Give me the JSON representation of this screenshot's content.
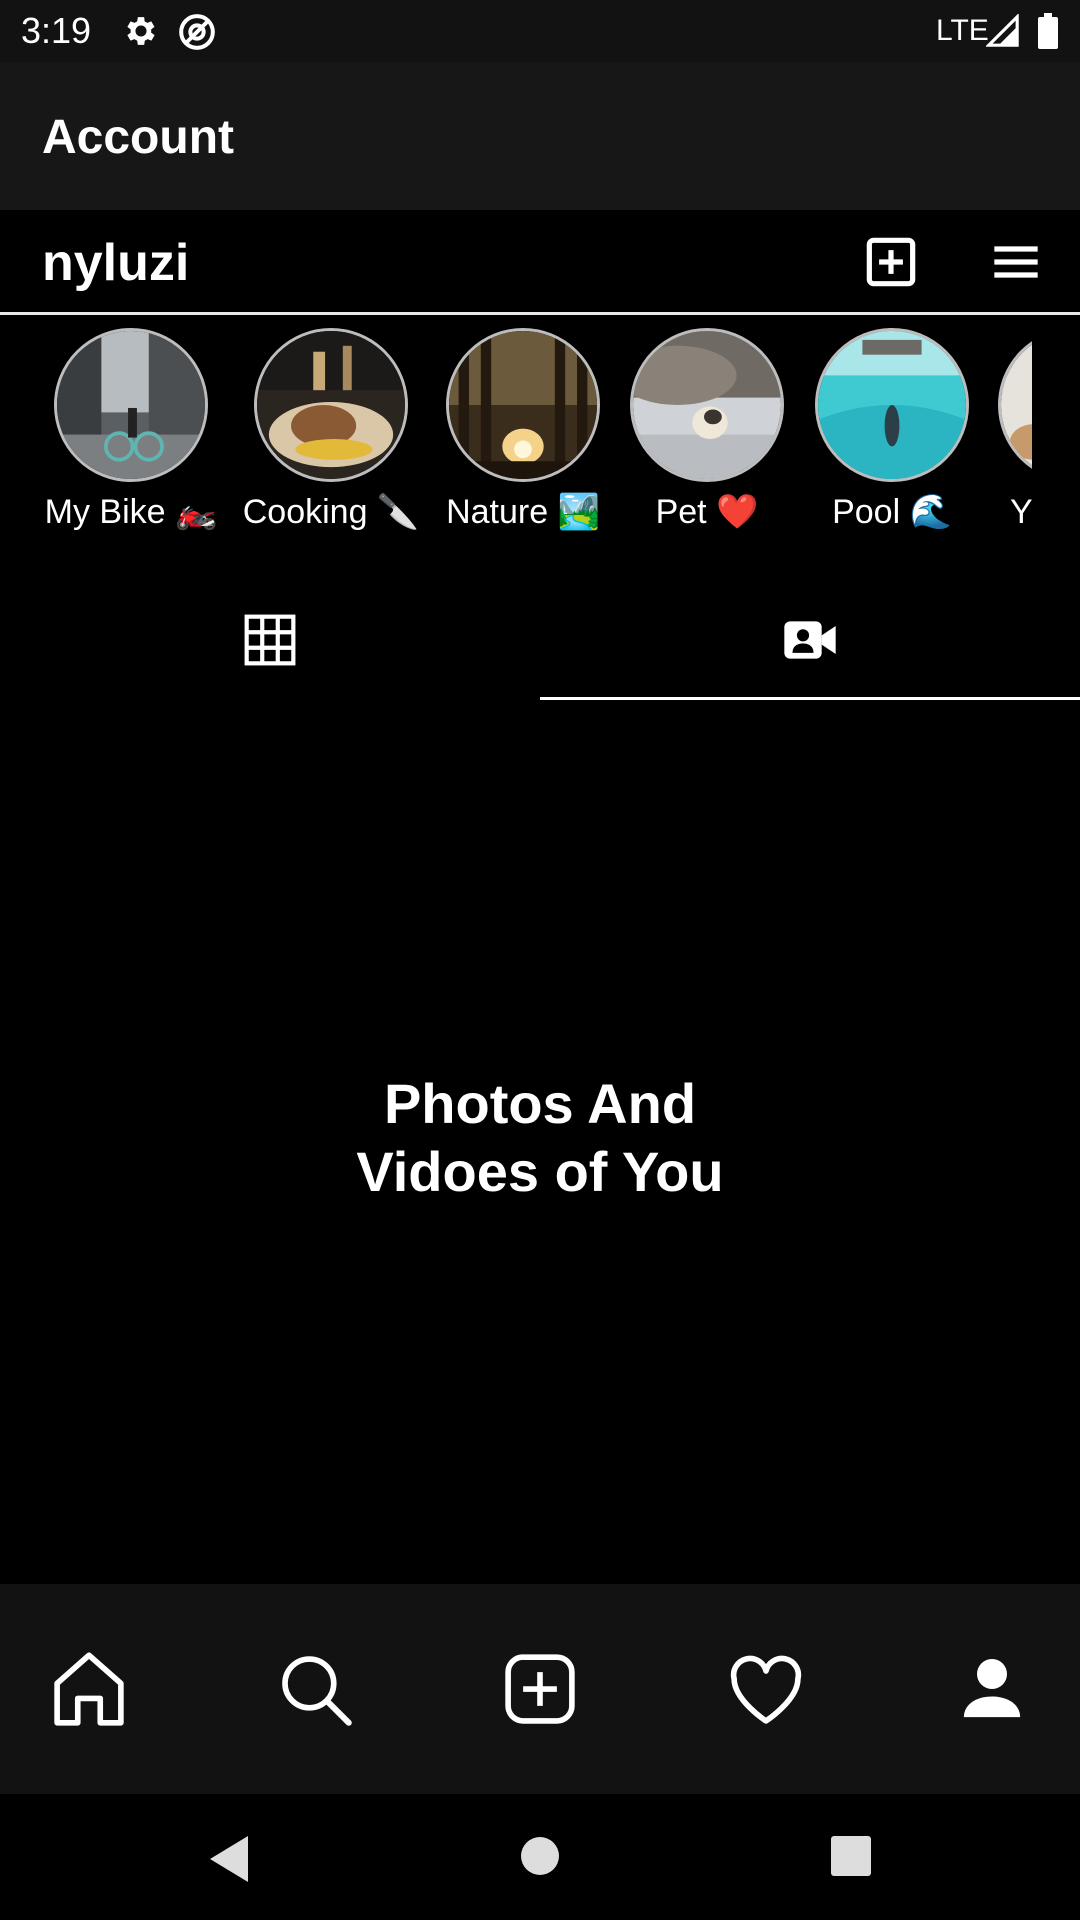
{
  "status_bar": {
    "time": "3:19",
    "network": "LTE",
    "icons": [
      "settings-icon",
      "at-sign-icon",
      "signal-icon",
      "battery-icon"
    ]
  },
  "app_bar": {
    "title": "Account"
  },
  "profile": {
    "username": "nyluzi",
    "actions": [
      "add-post-icon",
      "menu-icon"
    ]
  },
  "highlights": [
    {
      "label": "My Bike 🏍️"
    },
    {
      "label": "Cooking 🔪"
    },
    {
      "label": "Nature 🏞️"
    },
    {
      "label": "Pet ❤️"
    },
    {
      "label": "Pool 🌊"
    },
    {
      "label": "Y"
    }
  ],
  "tabs": [
    {
      "icon": "grid-icon",
      "selected": false
    },
    {
      "icon": "tagged-video-icon",
      "selected": true
    }
  ],
  "content": {
    "empty_line1": "Photos And",
    "empty_line2": "Vidoes of You"
  },
  "bottom_nav": [
    "home-icon",
    "search-icon",
    "add-icon",
    "heart-icon",
    "profile-icon"
  ],
  "system_nav": [
    "back-icon",
    "home-circle-icon",
    "recents-icon"
  ]
}
